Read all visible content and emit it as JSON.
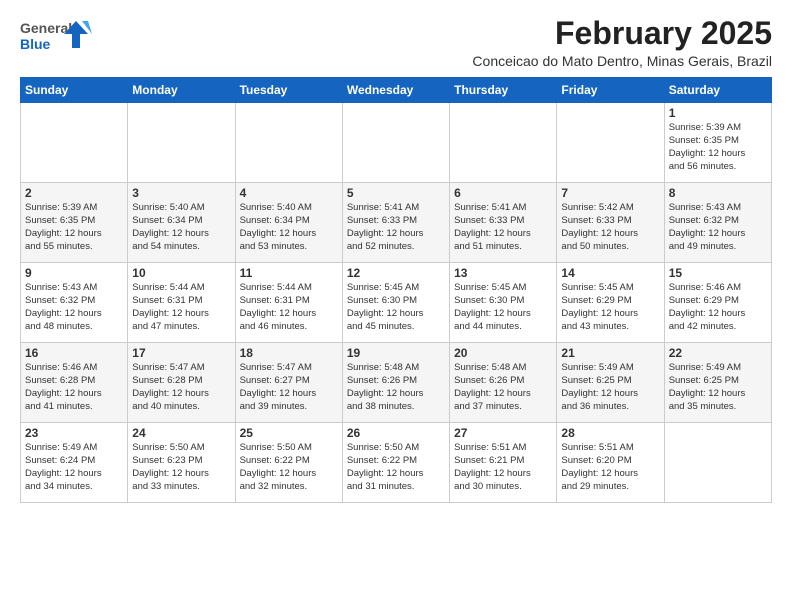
{
  "header": {
    "logo_general": "General",
    "logo_blue": "Blue",
    "month_title": "February 2025",
    "location": "Conceicao do Mato Dentro, Minas Gerais, Brazil"
  },
  "weekdays": [
    "Sunday",
    "Monday",
    "Tuesday",
    "Wednesday",
    "Thursday",
    "Friday",
    "Saturday"
  ],
  "weeks": [
    [
      {
        "day": "",
        "info": ""
      },
      {
        "day": "",
        "info": ""
      },
      {
        "day": "",
        "info": ""
      },
      {
        "day": "",
        "info": ""
      },
      {
        "day": "",
        "info": ""
      },
      {
        "day": "",
        "info": ""
      },
      {
        "day": "1",
        "info": "Sunrise: 5:39 AM\nSunset: 6:35 PM\nDaylight: 12 hours\nand 56 minutes."
      }
    ],
    [
      {
        "day": "2",
        "info": "Sunrise: 5:39 AM\nSunset: 6:35 PM\nDaylight: 12 hours\nand 55 minutes."
      },
      {
        "day": "3",
        "info": "Sunrise: 5:40 AM\nSunset: 6:34 PM\nDaylight: 12 hours\nand 54 minutes."
      },
      {
        "day": "4",
        "info": "Sunrise: 5:40 AM\nSunset: 6:34 PM\nDaylight: 12 hours\nand 53 minutes."
      },
      {
        "day": "5",
        "info": "Sunrise: 5:41 AM\nSunset: 6:33 PM\nDaylight: 12 hours\nand 52 minutes."
      },
      {
        "day": "6",
        "info": "Sunrise: 5:41 AM\nSunset: 6:33 PM\nDaylight: 12 hours\nand 51 minutes."
      },
      {
        "day": "7",
        "info": "Sunrise: 5:42 AM\nSunset: 6:33 PM\nDaylight: 12 hours\nand 50 minutes."
      },
      {
        "day": "8",
        "info": "Sunrise: 5:43 AM\nSunset: 6:32 PM\nDaylight: 12 hours\nand 49 minutes."
      }
    ],
    [
      {
        "day": "9",
        "info": "Sunrise: 5:43 AM\nSunset: 6:32 PM\nDaylight: 12 hours\nand 48 minutes."
      },
      {
        "day": "10",
        "info": "Sunrise: 5:44 AM\nSunset: 6:31 PM\nDaylight: 12 hours\nand 47 minutes."
      },
      {
        "day": "11",
        "info": "Sunrise: 5:44 AM\nSunset: 6:31 PM\nDaylight: 12 hours\nand 46 minutes."
      },
      {
        "day": "12",
        "info": "Sunrise: 5:45 AM\nSunset: 6:30 PM\nDaylight: 12 hours\nand 45 minutes."
      },
      {
        "day": "13",
        "info": "Sunrise: 5:45 AM\nSunset: 6:30 PM\nDaylight: 12 hours\nand 44 minutes."
      },
      {
        "day": "14",
        "info": "Sunrise: 5:45 AM\nSunset: 6:29 PM\nDaylight: 12 hours\nand 43 minutes."
      },
      {
        "day": "15",
        "info": "Sunrise: 5:46 AM\nSunset: 6:29 PM\nDaylight: 12 hours\nand 42 minutes."
      }
    ],
    [
      {
        "day": "16",
        "info": "Sunrise: 5:46 AM\nSunset: 6:28 PM\nDaylight: 12 hours\nand 41 minutes."
      },
      {
        "day": "17",
        "info": "Sunrise: 5:47 AM\nSunset: 6:28 PM\nDaylight: 12 hours\nand 40 minutes."
      },
      {
        "day": "18",
        "info": "Sunrise: 5:47 AM\nSunset: 6:27 PM\nDaylight: 12 hours\nand 39 minutes."
      },
      {
        "day": "19",
        "info": "Sunrise: 5:48 AM\nSunset: 6:26 PM\nDaylight: 12 hours\nand 38 minutes."
      },
      {
        "day": "20",
        "info": "Sunrise: 5:48 AM\nSunset: 6:26 PM\nDaylight: 12 hours\nand 37 minutes."
      },
      {
        "day": "21",
        "info": "Sunrise: 5:49 AM\nSunset: 6:25 PM\nDaylight: 12 hours\nand 36 minutes."
      },
      {
        "day": "22",
        "info": "Sunrise: 5:49 AM\nSunset: 6:25 PM\nDaylight: 12 hours\nand 35 minutes."
      }
    ],
    [
      {
        "day": "23",
        "info": "Sunrise: 5:49 AM\nSunset: 6:24 PM\nDaylight: 12 hours\nand 34 minutes."
      },
      {
        "day": "24",
        "info": "Sunrise: 5:50 AM\nSunset: 6:23 PM\nDaylight: 12 hours\nand 33 minutes."
      },
      {
        "day": "25",
        "info": "Sunrise: 5:50 AM\nSunset: 6:22 PM\nDaylight: 12 hours\nand 32 minutes."
      },
      {
        "day": "26",
        "info": "Sunrise: 5:50 AM\nSunset: 6:22 PM\nDaylight: 12 hours\nand 31 minutes."
      },
      {
        "day": "27",
        "info": "Sunrise: 5:51 AM\nSunset: 6:21 PM\nDaylight: 12 hours\nand 30 minutes."
      },
      {
        "day": "28",
        "info": "Sunrise: 5:51 AM\nSunset: 6:20 PM\nDaylight: 12 hours\nand 29 minutes."
      },
      {
        "day": "",
        "info": ""
      }
    ]
  ]
}
